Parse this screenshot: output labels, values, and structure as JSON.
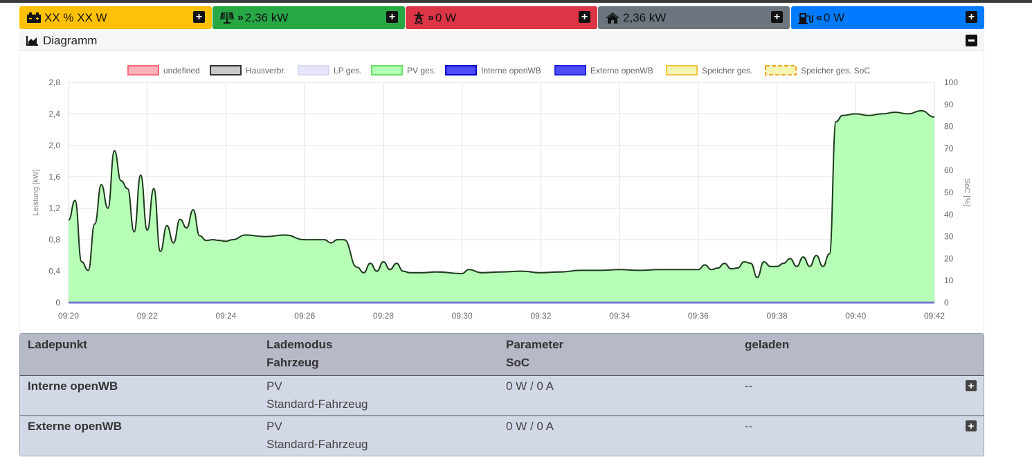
{
  "tiles": {
    "battery": {
      "value": "XX % XX W",
      "icon": "battery-icon",
      "color": "#ffc107"
    },
    "pv": {
      "chevron": "»",
      "value": "2,36 kW",
      "icon": "solar-panel-icon",
      "color": "#28a745"
    },
    "grid": {
      "chevron": "»",
      "value": "0 W",
      "icon": "power-tower-icon",
      "color": "#dc3545"
    },
    "house": {
      "value": "2,36 kW",
      "icon": "home-icon",
      "color": "#6c757d"
    },
    "charge": {
      "chevron": "«",
      "value": "0 W",
      "icon": "charging-station-icon",
      "color": "#007bff"
    }
  },
  "diagram": {
    "title": "Diagramm",
    "icon": "area-chart-icon"
  },
  "chart_data": {
    "type": "area",
    "legend_position": "top",
    "legend": [
      {
        "name": "undefined",
        "fill": "#ffb3b8",
        "stroke": "#ff6b7a",
        "dashed": false
      },
      {
        "name": "Hausverbr.",
        "fill": "#c8c8c8",
        "stroke": "#333333",
        "dashed": false
      },
      {
        "name": "LP ges.",
        "fill": "#e6e6fa",
        "stroke": "#d8d8f0",
        "dashed": false
      },
      {
        "name": "PV ges.",
        "fill": "#b3ffb3",
        "stroke": "#66dd66",
        "dashed": false
      },
      {
        "name": "Interne openWB",
        "fill": "#4d4dff",
        "stroke": "#0000cc",
        "dashed": false
      },
      {
        "name": "Externe openWB",
        "fill": "#4d4dff",
        "stroke": "#2222dd",
        "dashed": false
      },
      {
        "name": "Speicher ges.",
        "fill": "#f5f5b3",
        "stroke": "#f5c542",
        "dashed": false
      },
      {
        "name": "Speicher ges. SoC",
        "fill": "#f5f5b3",
        "stroke": "#f5a623",
        "dashed": true
      }
    ],
    "ylabel": "Leistung [kW]",
    "y2label": "SoC [%]",
    "ylim": [
      0,
      2.8
    ],
    "y2lim": [
      0,
      100
    ],
    "yticks": [
      "0",
      "0,4",
      "0,8",
      "1,2",
      "1,6",
      "2,0",
      "2,4",
      "2,8"
    ],
    "y2ticks": [
      "0",
      "10",
      "20",
      "30",
      "40",
      "50",
      "60",
      "70",
      "80",
      "90",
      "100"
    ],
    "xticks": [
      "09:20",
      "09:22",
      "09:24",
      "09:26",
      "09:28",
      "09:30",
      "09:32",
      "09:34",
      "09:36",
      "09:38",
      "09:40",
      "09:42"
    ],
    "xlim": [
      "09:20",
      "09:42"
    ],
    "grid": true,
    "series": [
      {
        "name": "PV ges.",
        "fill": "#b3ffb3",
        "x": [
          "09:20:00",
          "09:20:10",
          "09:20:20",
          "09:20:30",
          "09:20:40",
          "09:20:50",
          "09:21:00",
          "09:21:10",
          "09:21:20",
          "09:21:30",
          "09:21:40",
          "09:21:50",
          "09:22:00",
          "09:22:10",
          "09:22:20",
          "09:22:30",
          "09:22:40",
          "09:22:50",
          "09:23:00",
          "09:23:10",
          "09:23:20",
          "09:23:30",
          "09:23:40",
          "09:23:50",
          "09:24:00",
          "09:24:10",
          "09:24:30",
          "09:25:00",
          "09:25:30",
          "09:26:00",
          "09:26:20",
          "09:26:30",
          "09:26:40",
          "09:26:50",
          "09:27:00",
          "09:27:20",
          "09:27:30",
          "09:27:40",
          "09:27:50",
          "09:28:00",
          "09:28:10",
          "09:28:20",
          "09:28:30",
          "09:28:40",
          "09:28:50",
          "09:29:00",
          "09:29:20",
          "09:30:00",
          "09:30:10",
          "09:30:30",
          "09:31:00",
          "09:31:30",
          "09:32:00",
          "09:32:30",
          "09:33:00",
          "09:33:30",
          "09:34:00",
          "09:34:30",
          "09:35:00",
          "09:35:30",
          "09:36:00",
          "09:36:10",
          "09:36:20",
          "09:36:30",
          "09:36:40",
          "09:36:50",
          "09:37:00",
          "09:37:10",
          "09:37:20",
          "09:37:30",
          "09:37:40",
          "09:37:50",
          "09:38:00",
          "09:38:10",
          "09:38:20",
          "09:38:30",
          "09:38:40",
          "09:38:50",
          "09:39:00",
          "09:39:10",
          "09:39:20",
          "09:39:30",
          "09:39:40",
          "09:40:00",
          "09:40:20",
          "09:40:40",
          "09:41:00",
          "09:41:20",
          "09:41:40",
          "09:42:00"
        ],
        "y": [
          1.05,
          1.3,
          0.52,
          0.41,
          1.0,
          1.5,
          1.2,
          1.93,
          1.55,
          1.45,
          0.9,
          1.62,
          0.92,
          1.45,
          0.65,
          0.98,
          0.76,
          1.06,
          0.95,
          1.18,
          0.85,
          0.79,
          0.8,
          0.79,
          0.78,
          0.8,
          0.86,
          0.84,
          0.86,
          0.8,
          0.8,
          0.8,
          0.76,
          0.8,
          0.8,
          0.45,
          0.38,
          0.5,
          0.4,
          0.52,
          0.42,
          0.5,
          0.4,
          0.38,
          0.38,
          0.38,
          0.39,
          0.37,
          0.42,
          0.38,
          0.39,
          0.4,
          0.38,
          0.39,
          0.41,
          0.41,
          0.42,
          0.41,
          0.42,
          0.42,
          0.42,
          0.48,
          0.42,
          0.44,
          0.5,
          0.43,
          0.44,
          0.52,
          0.5,
          0.32,
          0.52,
          0.46,
          0.46,
          0.5,
          0.56,
          0.46,
          0.58,
          0.46,
          0.6,
          0.46,
          0.62,
          2.3,
          2.38,
          2.4,
          2.38,
          2.4,
          2.42,
          2.4,
          2.44,
          2.36
        ]
      },
      {
        "name": "Interne openWB",
        "x": [
          "09:20:00",
          "09:42:00"
        ],
        "y": [
          0,
          0
        ]
      }
    ]
  },
  "table": {
    "headers": [
      {
        "line1": "Ladepunkt",
        "line2": ""
      },
      {
        "line1": "Lademodus",
        "line2": "Fahrzeug"
      },
      {
        "line1": "Parameter",
        "line2": "SoC"
      },
      {
        "line1": "geladen",
        "line2": ""
      }
    ],
    "rows": [
      {
        "name": "Interne openWB",
        "mode": "PV",
        "vehicle": "Standard-Fahrzeug",
        "param": "0 W / 0 A",
        "charged": "--"
      },
      {
        "name": "Externe openWB",
        "mode": "PV",
        "vehicle": "Standard-Fahrzeug",
        "param": "0 W / 0 A",
        "charged": "--"
      }
    ]
  }
}
